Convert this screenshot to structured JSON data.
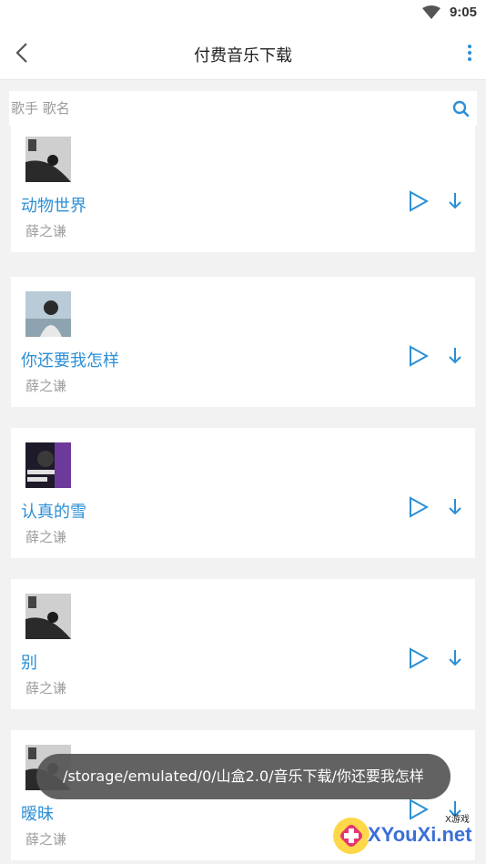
{
  "status_bar": {
    "time": "9:05",
    "wifi_icon": "wifi-icon"
  },
  "toolbar": {
    "title": "付费音乐下载",
    "back_icon": "back-arrow-icon",
    "more_icon": "more-vertical-icon"
  },
  "search": {
    "placeholder": "歌手 歌名",
    "value": "",
    "icon": "search-icon"
  },
  "songs": [
    {
      "title": "动物世界",
      "artist": "薛之谦",
      "cover": "album-cover-1"
    },
    {
      "title": "你还要我怎样",
      "artist": "薛之谦",
      "cover": "album-cover-2"
    },
    {
      "title": "认真的雪",
      "artist": "薛之谦",
      "cover": "album-cover-3"
    },
    {
      "title": "别",
      "artist": "薛之谦",
      "cover": "album-cover-4"
    },
    {
      "title": "暧昧",
      "artist": "薛之谦",
      "cover": "album-cover-5"
    }
  ],
  "toast": {
    "text": "/storage/emulated/0/山盒2.0/音乐下载/你还要我怎样"
  },
  "watermark": {
    "brand": "XYouXi.net",
    "sub": "X游戏"
  },
  "colors": {
    "accent": "#2b8fd6",
    "artist_gray": "#9e9e9e",
    "background": "#f2f2f2"
  }
}
